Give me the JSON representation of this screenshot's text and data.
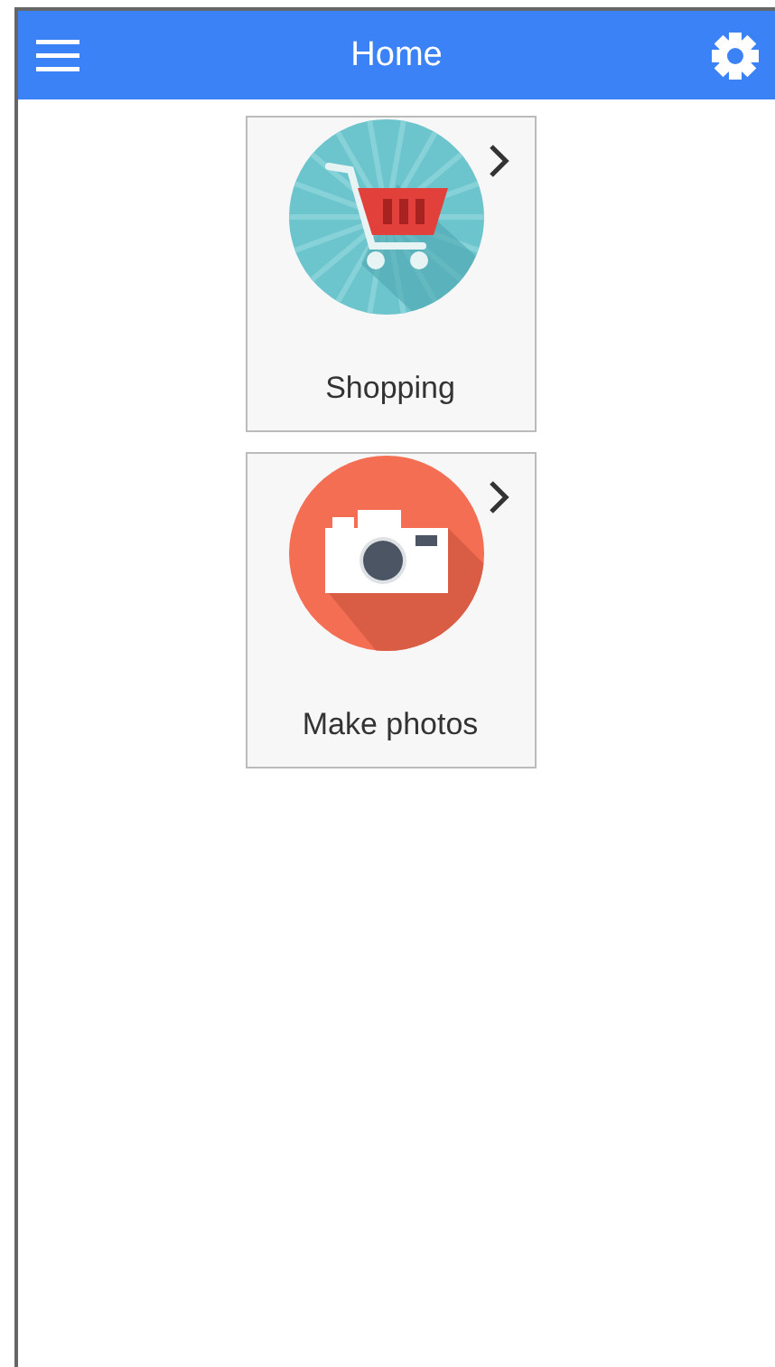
{
  "header": {
    "title": "Home"
  },
  "tiles": [
    {
      "kind": "cart",
      "label": "Shopping"
    },
    {
      "kind": "camera",
      "label": "Make photos"
    }
  ]
}
